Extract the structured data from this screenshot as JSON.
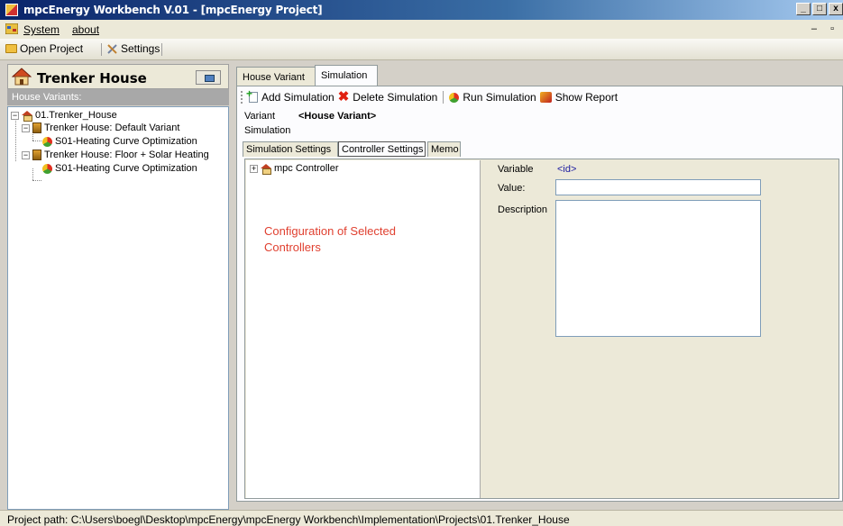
{
  "window": {
    "title": "mpcEnergy Workbench V.01 - [mpcEnergy Project]",
    "buttons": [
      "_",
      "□",
      "x"
    ]
  },
  "menu": {
    "items": [
      {
        "label": "System"
      },
      {
        "label": "about"
      }
    ],
    "mdi_controls": "– ▫"
  },
  "toolbar": {
    "open_project": "Open Project",
    "settings": "Settings"
  },
  "left_panel": {
    "house_title": "Trenker House",
    "variants_label": "House Variants:",
    "tree": {
      "root": "01.Trenker_House",
      "variants": [
        {
          "label": "Trenker House: Default Variant",
          "simulation": "S01-Heating Curve Optimization"
        },
        {
          "label": "Trenker House: Floor + Solar Heating",
          "simulation": "S01-Heating Curve Optimization"
        }
      ]
    }
  },
  "main": {
    "tabs": [
      {
        "label": "House Variant"
      },
      {
        "label": "Simulation",
        "active": true
      }
    ],
    "sim_toolbar": {
      "add": "Add Simulation",
      "delete": "Delete Simulation",
      "run": "Run Simulation",
      "report": "Show Report"
    },
    "variant_label": "Variant",
    "variant_value": "<House Variant>",
    "simulation_label": "Simulation",
    "inner_tabs": [
      {
        "label": "Simulation Settings"
      },
      {
        "label": "Controller Settings",
        "active": true
      },
      {
        "label": "Memo"
      }
    ],
    "controller_tree_root": "mpc Controller",
    "config_note_line1": "Configuration of Selected",
    "config_note_line2": "Controllers",
    "fields": {
      "variable_label": "Variable",
      "variable_value": "<id>",
      "value_label": "Value:",
      "value": "",
      "description_label": "Description",
      "description": ""
    }
  },
  "statusbar": {
    "path": "Project path: C:\\Users\\boegl\\Desktop\\mpcEnergy\\mpcEnergy Workbench\\Implementation\\Projects\\01.Trenker_House"
  }
}
